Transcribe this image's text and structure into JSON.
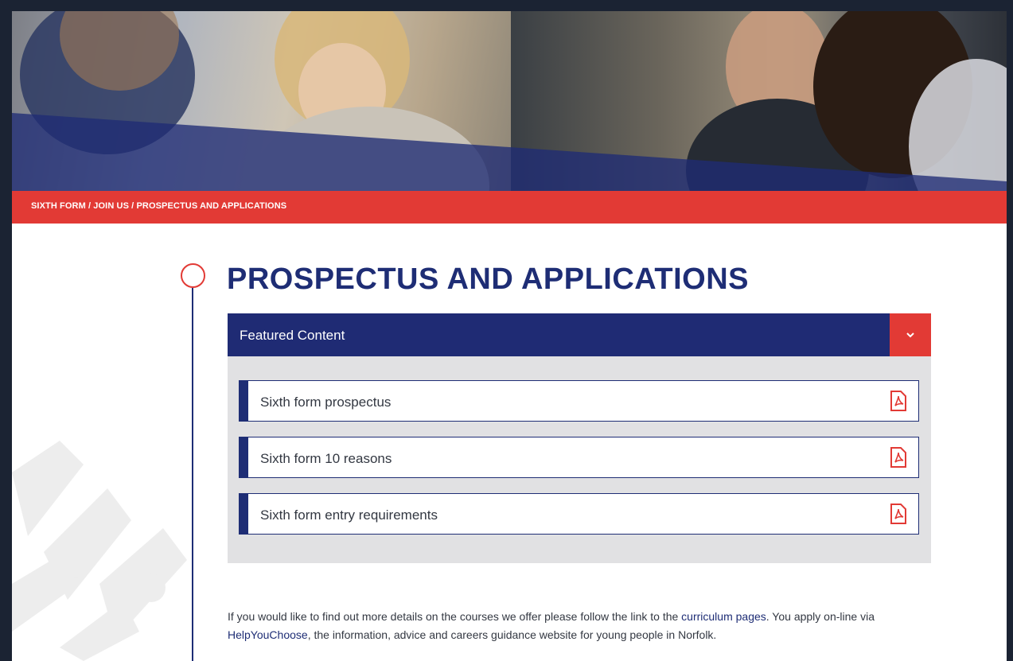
{
  "breadcrumb": {
    "text": "SIXTH FORM / JOIN US / PROSPECTUS AND APPLICATIONS"
  },
  "page": {
    "title": "PROSPECTUS AND APPLICATIONS"
  },
  "featured": {
    "title": "Featured Content",
    "toggle_icon": "chevron-down-icon",
    "items": [
      {
        "label": "Sixth form prospectus",
        "icon": "pdf-icon"
      },
      {
        "label": "Sixth form 10 reasons",
        "icon": "pdf-icon"
      },
      {
        "label": "Sixth form entry requirements",
        "icon": "pdf-icon"
      }
    ]
  },
  "paragraph": {
    "text_1": "If you would like to find out more details on the courses we offer please follow the link to the ",
    "link_1": "curriculum pages",
    "text_2": ". You apply on-line via ",
    "link_2": "HelpYouChoose",
    "text_3": ", the information, advice and careers guidance website for young people in Norfolk."
  },
  "colors": {
    "navy": "#1e2d75",
    "red": "#e23a35",
    "panel_grey": "#e1e1e3",
    "text": "#333842"
  }
}
